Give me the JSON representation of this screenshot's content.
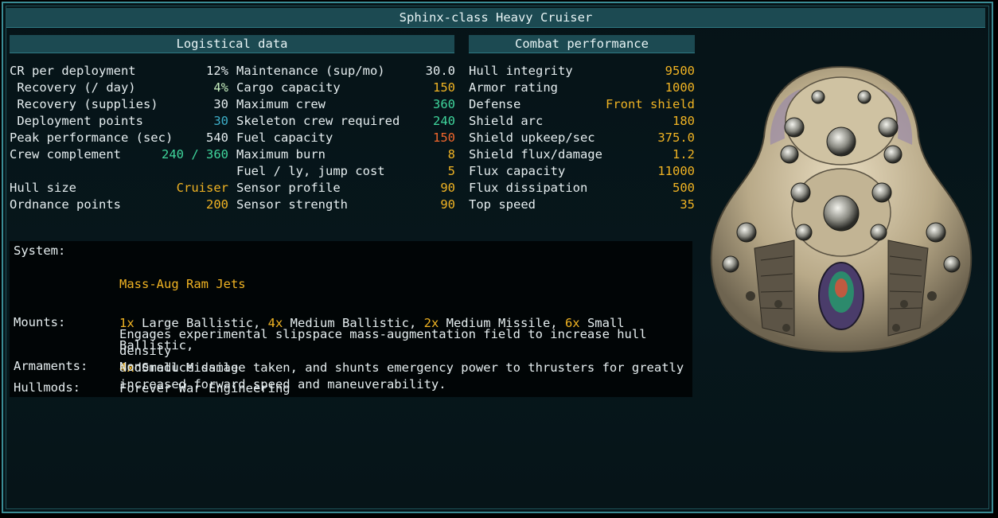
{
  "window": {
    "title": "Sphinx-class Heavy Cruiser"
  },
  "sections": {
    "logistics_header": "Logistical data",
    "combat_header": "Combat performance"
  },
  "logistics_col1": [
    {
      "label": "CR per deployment",
      "value": "12%",
      "color": "white"
    },
    {
      "label": " Recovery (/ day)",
      "value": "4%",
      "color": "light"
    },
    {
      "label": " Recovery (supplies)",
      "value": "30",
      "color": "white"
    },
    {
      "label": " Deployment points",
      "value": "30",
      "color": "cyan"
    },
    {
      "label": "Peak performance (sec)",
      "value": "540",
      "color": "white"
    },
    {
      "label": "Crew complement",
      "value": "240 / 360",
      "color": "green"
    },
    {
      "label": "",
      "value": "",
      "color": "white"
    },
    {
      "label": "Hull size",
      "value": "Cruiser",
      "color": "yellow"
    },
    {
      "label": "Ordnance points",
      "value": "200",
      "color": "yellow"
    }
  ],
  "logistics_col2": [
    {
      "label": "Maintenance (sup/mo)",
      "value": "30.0",
      "color": "white"
    },
    {
      "label": "Cargo capacity",
      "value": "150",
      "color": "yellow"
    },
    {
      "label": "Maximum crew",
      "value": "360",
      "color": "green"
    },
    {
      "label": "Skeleton crew required",
      "value": "240",
      "color": "green"
    },
    {
      "label": "Fuel capacity",
      "value": "150",
      "color": "orange"
    },
    {
      "label": "Maximum burn",
      "value": "8",
      "color": "yellow"
    },
    {
      "label": "Fuel / ly, jump cost",
      "value": "5",
      "color": "yellow"
    },
    {
      "label": "Sensor profile",
      "value": "90",
      "color": "yellow"
    },
    {
      "label": "Sensor strength",
      "value": "90",
      "color": "yellow"
    }
  ],
  "combat": [
    {
      "label": "Hull integrity",
      "value": "9500",
      "color": "yellow"
    },
    {
      "label": "Armor rating",
      "value": "1000",
      "color": "yellow"
    },
    {
      "label": "Defense",
      "value": "Front shield",
      "color": "yellow"
    },
    {
      "label": "Shield arc",
      "value": "180",
      "color": "yellow"
    },
    {
      "label": "Shield upkeep/sec",
      "value": "375.0",
      "color": "yellow"
    },
    {
      "label": "Shield flux/damage",
      "value": "1.2",
      "color": "yellow"
    },
    {
      "label": "Flux capacity",
      "value": "11000",
      "color": "yellow"
    },
    {
      "label": "Flux dissipation",
      "value": "500",
      "color": "yellow"
    },
    {
      "label": "Top speed",
      "value": "35",
      "color": "yellow"
    }
  ],
  "system": {
    "label": "System:",
    "name": "Mass-Aug Ram Jets",
    "description": "Engages experimental slipspace mass-augmentation field to increase hull density\nand reduce damage taken, and shunts emergency power to thrusters for greatly\nincreased forward speed and maneuverability."
  },
  "mounts": {
    "label": "Mounts:",
    "items": [
      {
        "count": "1x",
        "name": " Large Ballistic, "
      },
      {
        "count": "4x",
        "name": " Medium Ballistic, "
      },
      {
        "count": "2x",
        "name": " Medium Missile, "
      },
      {
        "count": "6x",
        "name": " Small Ballistic,"
      },
      {
        "count": "4x",
        "name": " Small Missile"
      }
    ]
  },
  "armaments": {
    "label": "Armaments:",
    "value": "None"
  },
  "hullmods": {
    "label": "Hullmods:",
    "value": "Forever War Engineering"
  },
  "colors": {
    "white": "#e6eef0",
    "yellow": "#f0b323",
    "green": "#3fd59c",
    "cyan": "#3dafc9",
    "orange": "#f0662c",
    "light": "#c8f0c0"
  },
  "ship_image": "sphinx-cruiser-sprite"
}
